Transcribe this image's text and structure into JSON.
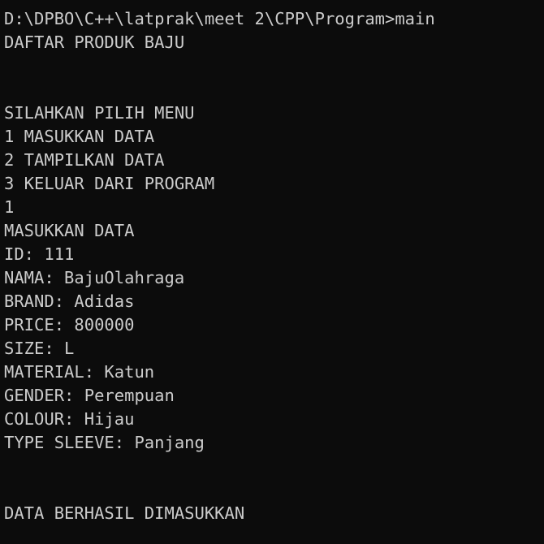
{
  "theme": {
    "background": "#0c0c0c",
    "foreground": "#cccccc"
  },
  "terminal": {
    "lines": [
      "D:\\DPBO\\C++\\latprak\\meet 2\\CPP\\Program>main",
      "DAFTAR PRODUK BAJU",
      "",
      "",
      "SILAHKAN PILIH MENU",
      "1 MASUKKAN DATA",
      "2 TAMPILKAN DATA",
      "3 KELUAR DARI PROGRAM",
      "1",
      "MASUKKAN DATA",
      "ID: 111",
      "NAMA: BajuOlahraga",
      "BRAND: Adidas",
      "PRICE: 800000",
      "SIZE: L",
      "MATERIAL: Katun",
      "GENDER: Perempuan",
      "COLOUR: Hijau",
      "TYPE SLEEVE: Panjang",
      "",
      "",
      "DATA BERHASIL DIMASUKKAN"
    ]
  }
}
